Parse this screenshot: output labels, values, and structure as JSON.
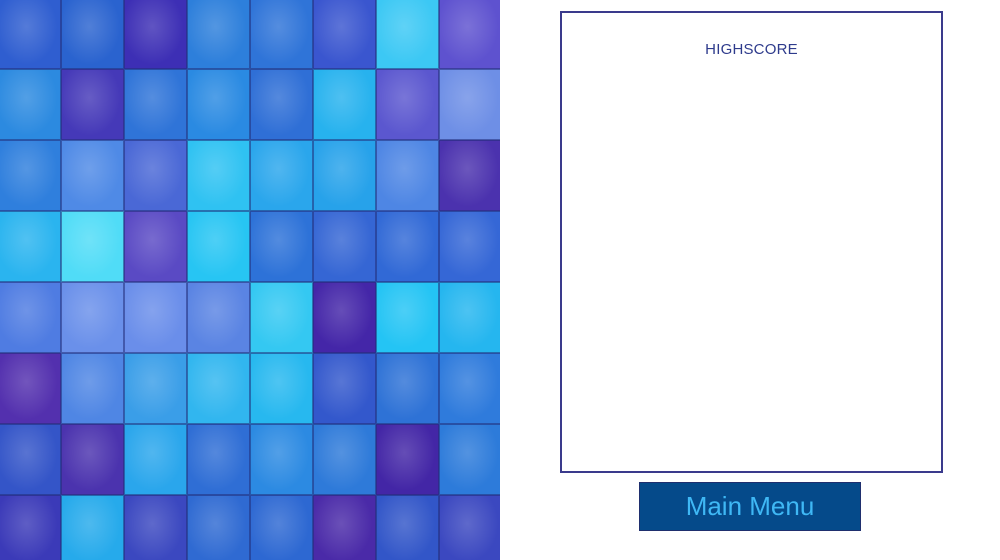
{
  "highscore": {
    "title": "HIGHSCORE"
  },
  "menu": {
    "main_menu_label": "Main Menu"
  },
  "board": {
    "rows": 8,
    "cols": 8,
    "tile_colors": [
      [
        "#2f5ed0",
        "#2a63cf",
        "#3d2fb5",
        "#2d7fdb",
        "#2f74d8",
        "#3a56cf",
        "#3cc8f4",
        "#5e52cf"
      ],
      [
        "#2c8ae0",
        "#4539b8",
        "#2f74d8",
        "#2a8ae2",
        "#2f6fd6",
        "#27b2ee",
        "#5b57cf",
        "#6e8fe6"
      ],
      [
        "#2f7fdd",
        "#4f8ae6",
        "#4a68d6",
        "#2fc2f2",
        "#2aa6ec",
        "#27a2ea",
        "#4e86e4",
        "#4b32ae"
      ],
      [
        "#2ab4ef",
        "#50dcf7",
        "#5a4ac4",
        "#27c5f3",
        "#2d72d8",
        "#3566d4",
        "#3169d6",
        "#3567d6"
      ],
      [
        "#4f7ce2",
        "#6a90ea",
        "#6a8eea",
        "#5a84e3",
        "#34c8f2",
        "#4426a8",
        "#24c4f4",
        "#25b6ef"
      ],
      [
        "#5330ae",
        "#4f86e4",
        "#3a9ee8",
        "#31b6ef",
        "#27b8ef",
        "#3358cc",
        "#2e72d6",
        "#2f7bdc"
      ],
      [
        "#3455c8",
        "#4b33ae",
        "#2aa6ec",
        "#2f6ed5",
        "#2c8ae2",
        "#2e7ad9",
        "#4326a6",
        "#2d7bda"
      ],
      [
        "#3b3ab8",
        "#26aaeb",
        "#3b48c0",
        "#2f6ad2",
        "#2d68d2",
        "#4a2aa8",
        "#3256c8",
        "#3b48c0"
      ]
    ]
  }
}
